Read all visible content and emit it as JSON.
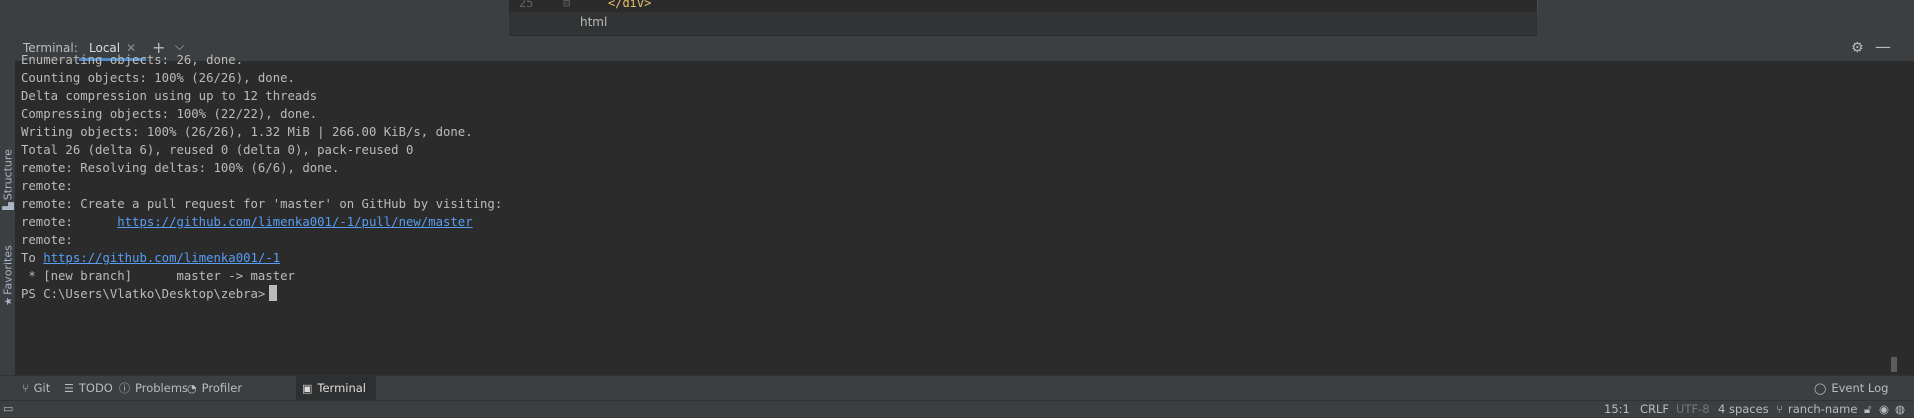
{
  "editor": {
    "line_number": "25",
    "code_text": "</div>",
    "breadcrumb": "html"
  },
  "side_tabs": {
    "structure": "Structure",
    "favorites": "Favorites"
  },
  "terminal": {
    "title": "Terminal:",
    "tab_label": "Local",
    "lines": [
      "Enumerating objects: 26, done.",
      "Counting objects: 100% (26/26), done.",
      "Delta compression using up to 12 threads",
      "Compressing objects: 100% (22/22), done.",
      "Writing objects: 100% (26/26), 1.32 MiB | 266.00 KiB/s, done.",
      "Total 26 (delta 6), reused 0 (delta 0), pack-reused 0",
      "remote: Resolving deltas: 100% (6/6), done.",
      "remote:",
      "remote: Create a pull request for 'master' on GitHub by visiting:",
      "remote:      ",
      "remote:",
      "To ",
      " * [new branch]      master -> master",
      "PS C:\\Users\\Vlatko\\Desktop\\zebra>"
    ],
    "pull_link": "https://github.com/limenka001/-1/pull/new/master",
    "repo_link": "https://github.com/limenka001/-1"
  },
  "tool_windows": [
    {
      "label": "Git",
      "icon": "git-branch-icon"
    },
    {
      "label": "TODO",
      "icon": "list-icon"
    },
    {
      "label": "Problems",
      "icon": "info-icon"
    },
    {
      "label": "Profiler",
      "icon": "profiler-icon"
    },
    {
      "label": "Terminal",
      "icon": "terminal-icon"
    }
  ],
  "event_log": "Event Log",
  "status": {
    "position": "15:1",
    "line_separator": "CRLF",
    "encoding": "UTF-8",
    "indent": "4 spaces",
    "branch": "ranch-name"
  },
  "colors": {
    "background": "#2b2b2b",
    "link": "#589df6",
    "active_tab_underline": "#4a88c7"
  }
}
